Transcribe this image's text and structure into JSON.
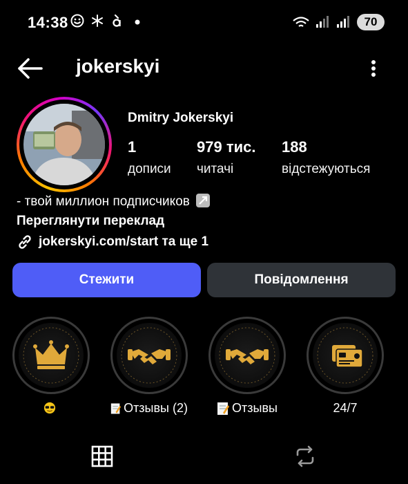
{
  "status_bar": {
    "time": "14:38",
    "battery": "70",
    "icons": [
      "smiley-icon",
      "snowflake-icon",
      "a-grave-icon",
      "dot-icon",
      "wifi-icon",
      "signal-icon",
      "signal-icon-2"
    ]
  },
  "header": {
    "username": "jokerskyi"
  },
  "profile": {
    "display_name": "Dmitry Jokerskyi",
    "stats": [
      {
        "value": "1",
        "label": "дописи"
      },
      {
        "value": "979 тис.",
        "label": "читачі"
      },
      {
        "value": "188",
        "label": "відстежуються"
      }
    ],
    "bio_line": "- твой миллион подписчиков",
    "translate_label": "Переглянути переклад",
    "link_text": "jokerskyi.com/start та ще 1"
  },
  "actions": {
    "follow_label": "Стежити",
    "message_label": "Повідомлення"
  },
  "highlights": [
    {
      "icon": "crown-icon",
      "label": "",
      "emoji": "sunglasses-emoji"
    },
    {
      "icon": "handshake-icon",
      "label": "Отзывы (2)",
      "emoji": "memo-emoji"
    },
    {
      "icon": "handshake-icon",
      "label": "Отзывы",
      "emoji": "memo-emoji"
    },
    {
      "icon": "id-card-icon",
      "label": "24/7",
      "emoji": ""
    }
  ],
  "colors": {
    "background": "#000000",
    "follow_button": "#4f5df7",
    "message_button": "#2f3338",
    "gold": "#e0a93a"
  }
}
